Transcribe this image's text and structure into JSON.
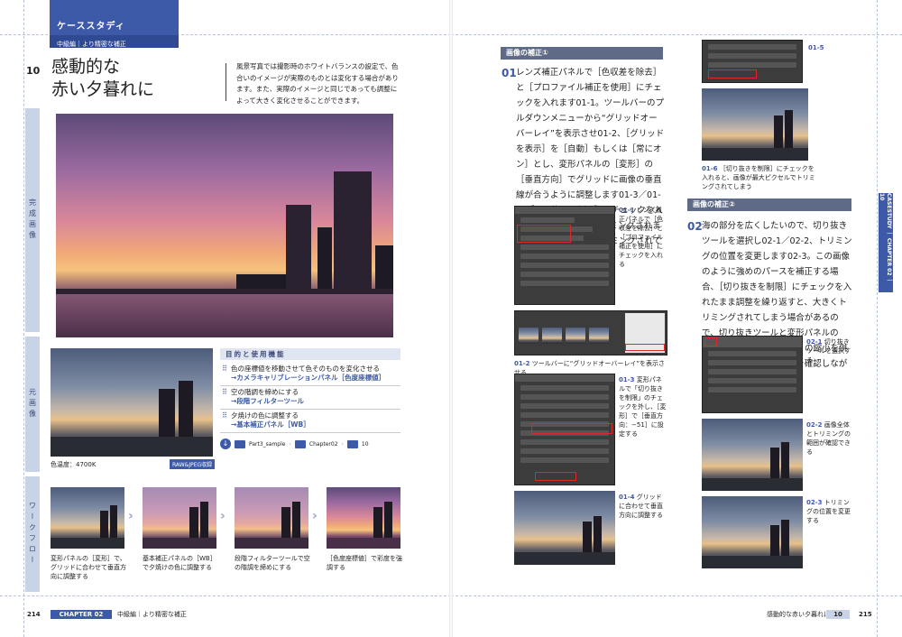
{
  "left": {
    "case_study_label": "ケーススタディ",
    "level": "中級編｜より精密な補正",
    "number": "10",
    "title_line1": "感動的な",
    "title_line2": "赤い夕暮れに",
    "intro": "風景写真では撮影時のホワイトバランスの設定で、色合いのイメージが実際のものとは変化する場合があります。また、実際のイメージと同じであっても調整によって大きく変化させることができます。",
    "side_tabs": [
      "完成画像",
      "元画像",
      "ワークフロー"
    ],
    "color_temp": "色温度：4700K",
    "raw_badge": "RAW&JPEG収録",
    "goals_head": "目的と使用機能",
    "goals": [
      {
        "goal": "色の座標値を移動させて色そのものを変化させる",
        "feature": "→カメラキャリブレーションパネル［色度座標値］"
      },
      {
        "goal": "空の階調を締めにする",
        "feature": "→段階フィルターツール"
      },
      {
        "goal": "夕焼けの色に調整する",
        "feature": "→基本補正パネル［WB］"
      }
    ],
    "path": [
      "Part3_sample",
      "Chapter02",
      "10"
    ],
    "workflow": [
      "変形パネルの［変形］で、グリッドに合わせて垂直方向に調整する",
      "基本補正パネルの［WB］で夕焼けの色に調整する",
      "段階フィルターツールで空の階調を締めにする",
      "［色度座標値］で彩度を強調する"
    ],
    "page_no": "214",
    "footer_chapter": "CHAPTER 02",
    "footer_text": "中級編｜より精密な補正"
  },
  "right": {
    "sec1_head": "画像の補正①",
    "step1_no": "01",
    "step1_text": "レンズ補正パネルで［色収差を除去］と［プロファイル補正を使用］にチェックを入れます01-1。ツールバーのプルダウンメニューから“グリッドオーバーレイ”を表示させ01-2、［グリッドを表示］を［自動］もしくは［常にオン］とし、変形パネルの［変形］の［垂直方向］でグリッドに画像の垂直線が合うように調整します01-3／01-4。［切り抜きを制限］にチェックを入れておくと、余白はトリミングされますが最大ピクセルでトリミングされてしまいます01-5／01-6。",
    "cap_01_1_no": "01-1",
    "cap_01_1": "レンズ補正パネルで［色収差を除去］と［プロファイル補正を使用］にチェックを入れる",
    "cap_01_2_no": "01-2",
    "cap_01_2": "ツールバーに“グリッドオーバーレイ”を表示させる",
    "cap_01_3_no": "01-3",
    "cap_01_3": "変形パネルで「切り抜きを制限」のチェックを外し、［変形］で［垂直方向：−51］に設定する",
    "cap_01_4_no": "01-4",
    "cap_01_4": "グリッドに合わせて垂直方向に調整する",
    "cap_01_5_no": "01-5",
    "cap_01_6_no": "01-6",
    "cap_01_6": "［切り抜きを制限］にチェックを入れると、画像が最大ピクセルでトリミングされてしまう",
    "sec2_head": "画像の補正②",
    "step2_no": "02",
    "step2_text": "海の部分を広くしたいので、切り抜きツールを選択し02-1／02-2、トリミングの位置を変更します02-3。この画像のように強めのパースを補正する場合、［切り抜きを制限］にチェックを入れたまま調整を繰り返すと、大きくトリミングされてしまう場合があるので、切り抜きツールと変形パネルの［変形］の［拡大・縮小］の縮小を併用してトリミングの状態を確認しながら調整してください。",
    "cap_02_1_no": "02-1",
    "cap_02_1": "切り抜きツールを選択する",
    "cap_02_2_no": "02-2",
    "cap_02_2": "画像全体とトリミングの範囲が確認できる",
    "cap_02_3_no": "02-3",
    "cap_02_3": "トリミングの位置を変更する",
    "side_tab": "CASESTUDY ｜ CHAPTER 02 ｜ 10",
    "footer_text": "感動的な赤い夕暮れに",
    "footer_no": "10",
    "page_no": "215"
  },
  "colors": {
    "accent": "#3d5aa8",
    "tab": "#c9d3e6",
    "section": "#5f6a86",
    "highlight": "#e0282c"
  }
}
